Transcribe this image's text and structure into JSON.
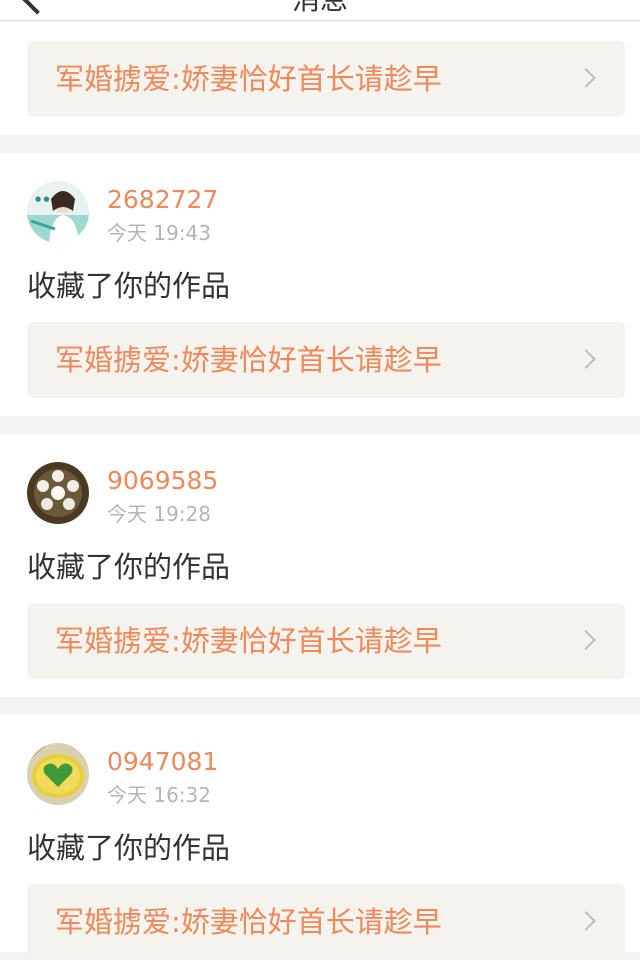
{
  "header": {
    "title_fragment": "消息"
  },
  "first_work": {
    "title": "军婚掳爱:娇妻恰好首长请趁早"
  },
  "notifications": [
    {
      "username": "2682727",
      "time": "今天 19:43",
      "action": "收藏了你的作品",
      "work_title": "军婚掳爱:娇妻恰好首长请趁早",
      "avatar": "woman-photo-avatar"
    },
    {
      "username": "9069585",
      "time": "今天 19:28",
      "action": "收藏了你的作品",
      "work_title": "军婚掳爱:娇妻恰好首长请趁早",
      "avatar": "pearl-brooch-avatar"
    },
    {
      "username": "0947081",
      "time": "今天 16:32",
      "action": "收藏了你的作品",
      "work_title": "军婚掳爱:娇妻恰好首长请趁早",
      "avatar": "green-heart-avatar"
    }
  ],
  "colors": {
    "accent": "#f0885a",
    "link_background": "#f4f3ee",
    "page_background": "#f4f4f4",
    "time_text": "#b5b5b5"
  }
}
